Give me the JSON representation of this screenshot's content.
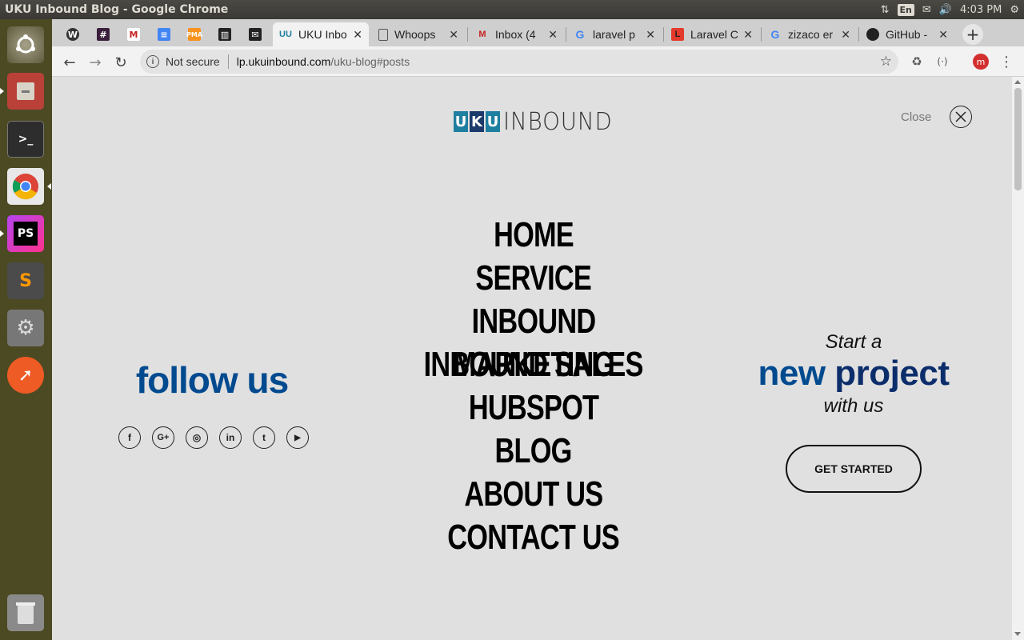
{
  "os": {
    "window_title": "UKU Inbound Blog - Google Chrome",
    "lang": "En",
    "clock": "4:03 PM"
  },
  "browser": {
    "tabs": [
      {
        "label": "UKU Inbo",
        "active": true
      },
      {
        "label": "Whoops"
      },
      {
        "label": "Inbox (4"
      },
      {
        "label": "laravel p"
      },
      {
        "label": "Laravel C"
      },
      {
        "label": "zizaco er"
      },
      {
        "label": "GitHub -"
      }
    ],
    "not_secure": "Not secure",
    "url_host": "lp.ukuinbound.com",
    "url_path": "/uku-blog#posts",
    "profile_initial": "m"
  },
  "page": {
    "logo_letters": [
      "U",
      "K",
      "U"
    ],
    "logo_text": "INBOUND",
    "close_label": "Close",
    "menu": [
      "HOME",
      "SERVICE",
      "INBOUND MARKETING",
      "INBOUND SALES",
      "HUBSPOT",
      "BLOG",
      "ABOUT US",
      "CONTACT US"
    ],
    "follow": "follow us",
    "socials": [
      "f",
      "G+",
      "◎",
      "in",
      "t",
      "▶"
    ],
    "cta_start": "Start a",
    "cta_new": "new",
    "cta_project": "project",
    "cta_with": "with us",
    "get_started": "GET STARTED"
  },
  "colors": {
    "brand_blue": "#004a8f",
    "logo_teal": "#1f7fa0",
    "logo_navy": "#1b3a6b"
  }
}
